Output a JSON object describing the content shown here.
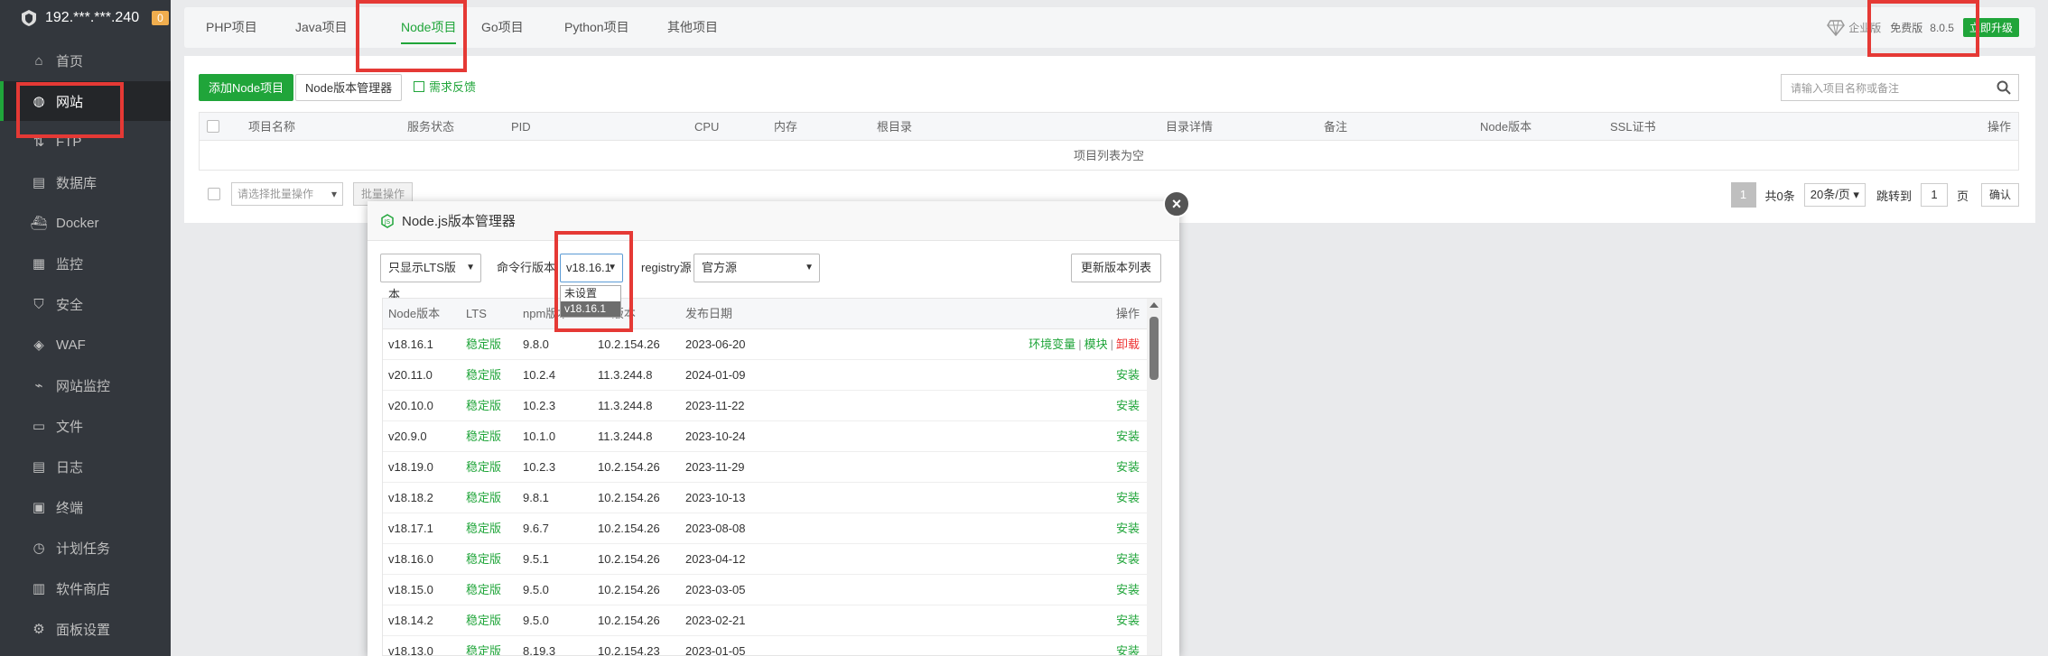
{
  "server": {
    "ip": "192.***.***.240",
    "badge": "0"
  },
  "sidebar": {
    "items": [
      {
        "label": "首页",
        "icon": "home-icon"
      },
      {
        "label": "网站",
        "icon": "globe-icon",
        "active": true
      },
      {
        "label": "FTP",
        "icon": "ftp-icon"
      },
      {
        "label": "数据库",
        "icon": "database-icon"
      },
      {
        "label": "Docker",
        "icon": "docker-icon"
      },
      {
        "label": "监控",
        "icon": "monitor-icon"
      },
      {
        "label": "安全",
        "icon": "shield-icon"
      },
      {
        "label": "WAF",
        "icon": "waf-icon"
      },
      {
        "label": "网站监控",
        "icon": "chart-icon"
      },
      {
        "label": "文件",
        "icon": "folder-icon"
      },
      {
        "label": "日志",
        "icon": "log-icon"
      },
      {
        "label": "终端",
        "icon": "terminal-icon"
      },
      {
        "label": "计划任务",
        "icon": "clock-icon"
      },
      {
        "label": "软件商店",
        "icon": "store-icon"
      },
      {
        "label": "面板设置",
        "icon": "gear-icon"
      }
    ]
  },
  "tabs": [
    "PHP项目",
    "Java项目",
    "Node项目",
    "Go项目",
    "Python项目",
    "其他项目"
  ],
  "version": {
    "enterprise": "企业版",
    "free": "免费版",
    "number": "8.0.5",
    "upgrade": "立即升级"
  },
  "toolbar": {
    "add": "添加Node项目",
    "manager": "Node版本管理器",
    "feedback": "需求反馈",
    "search_placeholder": "请输入项目名称或备注"
  },
  "table": {
    "headers": [
      "项目名称",
      "服务状态",
      "PID",
      "CPU",
      "内存",
      "根目录",
      "目录详情",
      "备注",
      "Node版本",
      "SSL证书",
      "操作"
    ],
    "empty": "项目列表为空"
  },
  "batch": {
    "select": "请选择批量操作",
    "button": "批量操作"
  },
  "pager": {
    "current": "1",
    "total": "共0条",
    "per_page": "20条/页",
    "jump": "跳转到",
    "jump_value": "1",
    "page": "页",
    "confirm": "确认"
  },
  "modal": {
    "title": "Node.js版本管理器",
    "lts_filter": "只显示LTS版本",
    "cli_label": "命令行版本",
    "cli_value": "v18.16.1",
    "registry_label": "registry源",
    "registry_value": "官方源",
    "update_button": "更新版本列表",
    "dropdown_options": [
      "未设置",
      "v18.16.1"
    ],
    "headers": [
      "Node版本",
      "LTS",
      "npm版本",
      "V8版本",
      "发布日期",
      "操作"
    ],
    "rows": [
      {
        "version": "v18.16.1",
        "lts": "稳定版",
        "npm": "9.8.0",
        "v8": "10.2.154.26",
        "date": "2023-06-20",
        "installed": true
      },
      {
        "version": "v20.11.0",
        "lts": "稳定版",
        "npm": "10.2.4",
        "v8": "11.3.244.8",
        "date": "2024-01-09"
      },
      {
        "version": "v20.10.0",
        "lts": "稳定版",
        "npm": "10.2.3",
        "v8": "11.3.244.8",
        "date": "2023-11-22"
      },
      {
        "version": "v20.9.0",
        "lts": "稳定版",
        "npm": "10.1.0",
        "v8": "11.3.244.8",
        "date": "2023-10-24"
      },
      {
        "version": "v18.19.0",
        "lts": "稳定版",
        "npm": "10.2.3",
        "v8": "10.2.154.26",
        "date": "2023-11-29"
      },
      {
        "version": "v18.18.2",
        "lts": "稳定版",
        "npm": "9.8.1",
        "v8": "10.2.154.26",
        "date": "2023-10-13"
      },
      {
        "version": "v18.17.1",
        "lts": "稳定版",
        "npm": "9.6.7",
        "v8": "10.2.154.26",
        "date": "2023-08-08"
      },
      {
        "version": "v18.16.0",
        "lts": "稳定版",
        "npm": "9.5.1",
        "v8": "10.2.154.26",
        "date": "2023-04-12"
      },
      {
        "version": "v18.15.0",
        "lts": "稳定版",
        "npm": "9.5.0",
        "v8": "10.2.154.26",
        "date": "2023-03-05"
      },
      {
        "version": "v18.14.2",
        "lts": "稳定版",
        "npm": "9.5.0",
        "v8": "10.2.154.26",
        "date": "2023-02-21"
      },
      {
        "version": "v18.13.0",
        "lts": "稳定版",
        "npm": "8.19.3",
        "v8": "10.2.154.23",
        "date": "2023-01-05"
      }
    ],
    "actions_installed": [
      "环境变量",
      "模块",
      "卸载"
    ],
    "action_install": "安装"
  },
  "colors": {
    "sidebar": "#33373d",
    "accent": "#20a53a",
    "annotation": "#e53935"
  }
}
